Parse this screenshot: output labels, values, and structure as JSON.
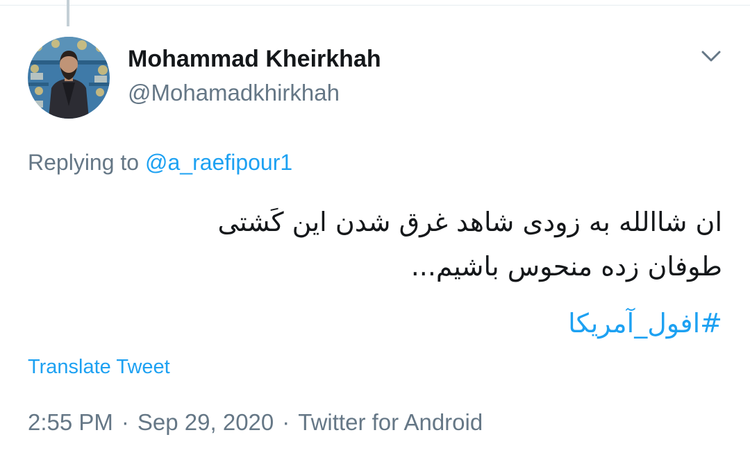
{
  "tweet": {
    "author": {
      "display_name": "Mohammad Kheirkhah",
      "handle": "@Mohamadkhirkhah"
    },
    "reply": {
      "prefix": "Replying to ",
      "mention": "@a_raefipour1"
    },
    "text_lines": [
      "ان شاالله به زودی شاهد غرق شدن این کَشتی",
      "طوفان زده منحوس باشیم..."
    ],
    "hashtag": "#افول_آمریکا",
    "translate_label": "Translate Tweet",
    "meta": {
      "time": "2:55 PM",
      "separator": "·",
      "date": "Sep 29, 2020",
      "source": "Twitter for Android"
    }
  },
  "icons": {
    "menu": "chevron-down-icon"
  },
  "colors": {
    "link": "#1da1f2",
    "secondary_text": "#657786",
    "primary_text": "#14171a"
  }
}
